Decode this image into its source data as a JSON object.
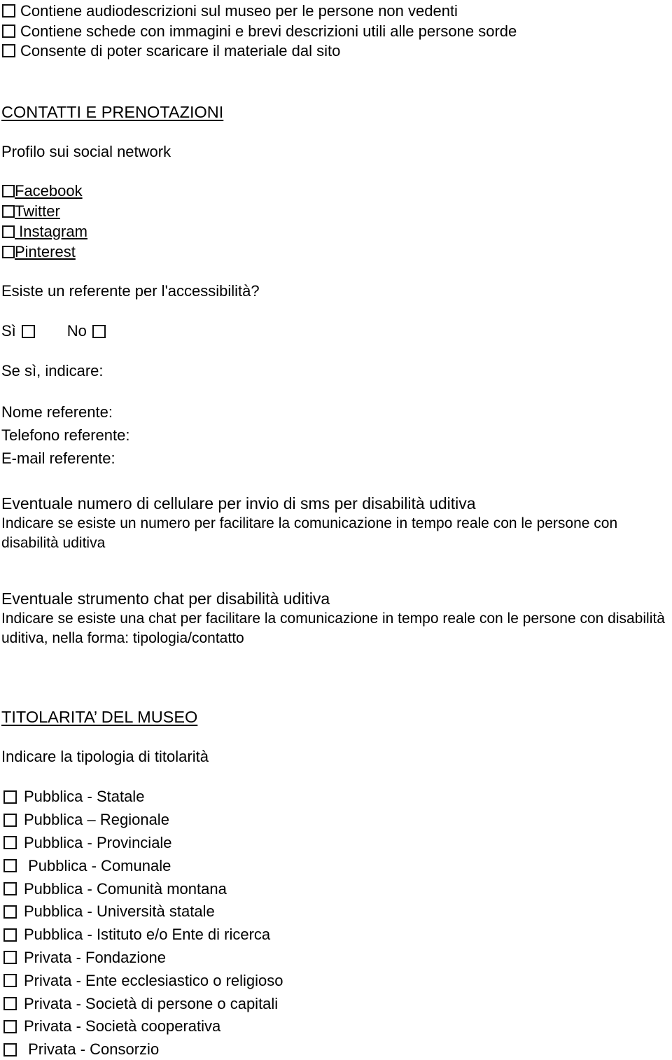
{
  "document": {
    "language": "it",
    "text_color": "#000000",
    "background_color": "#ffffff"
  },
  "top_checklist": {
    "items": [
      {
        "label": "Contiene audiodescrizioni sul museo per le persone non vedenti",
        "checked": false
      },
      {
        "label": "Contiene schede con immagini e brevi descrizioni utili alle persone sorde",
        "checked": false
      },
      {
        "label": "Consente di poter scaricare il materiale dal sito",
        "checked": false
      }
    ]
  },
  "contacts_section": {
    "heading": "CONTATTI E PRENOTAZIONI",
    "social_prompt": "Profilo sui social network",
    "social_links": [
      {
        "label": "Facebook",
        "checked": false
      },
      {
        "label": "Twitter",
        "checked": false
      },
      {
        "label": " Instagram",
        "checked": false
      },
      {
        "label": "Pinterest",
        "checked": false
      }
    ],
    "referent_question": "Esiste un referente per l'accessibilità?",
    "yes_label": "Sì",
    "no_label": "No",
    "yes_checked": false,
    "no_checked": false,
    "if_yes_label": "Se sì, indicare:",
    "fields": [
      {
        "label": "Nome referente:",
        "value": ""
      },
      {
        "label": "Telefono referente:",
        "value": ""
      },
      {
        "label": "E-mail referente:",
        "value": ""
      }
    ],
    "sms_block": {
      "lead": "Eventuale numero di cellulare per invio di sms per disabilità uditiva",
      "description": "Indicare se esiste un numero per facilitare la comunicazione in tempo reale con le persone con disabilità uditiva"
    },
    "chat_block": {
      "lead": "Eventuale strumento chat per disabilità uditiva",
      "description": "Indicare se esiste una chat per facilitare la comunicazione in tempo reale con le persone con disabilità uditiva, nella forma: tipologia/contatto"
    }
  },
  "ownership_section": {
    "heading": "TITOLARITA’ DEL MUSEO",
    "prompt": "Indicare la tipologia di titolarità",
    "options": [
      {
        "label": "Pubblica - Statale",
        "checked": false
      },
      {
        "label": "Pubblica – Regionale",
        "checked": false
      },
      {
        "label": "Pubblica - Provinciale",
        "checked": false
      },
      {
        "label": " Pubblica - Comunale",
        "checked": false
      },
      {
        "label": "Pubblica - Comunità montana",
        "checked": false
      },
      {
        "label": "Pubblica - Università statale",
        "checked": false
      },
      {
        "label": "Pubblica - Istituto e/o Ente di ricerca",
        "checked": false
      },
      {
        "label": "Privata - Fondazione",
        "checked": false
      },
      {
        "label": "Privata - Ente ecclesiastico o religioso",
        "checked": false
      },
      {
        "label": "Privata - Società di persone o capitali",
        "checked": false
      },
      {
        "label": "Privata - Società cooperativa",
        "checked": false
      },
      {
        "label": " Privata - Consorzio",
        "checked": false
      }
    ]
  }
}
